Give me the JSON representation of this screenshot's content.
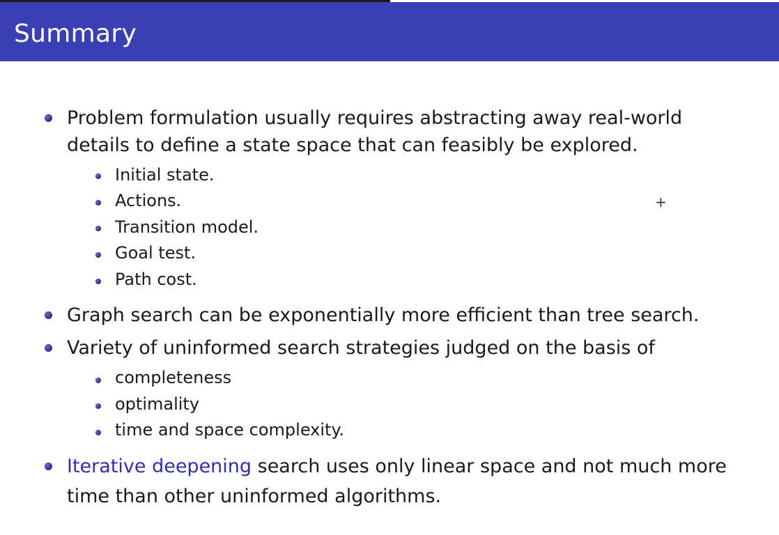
{
  "slide": {
    "title": "Summary",
    "bullets": [
      {
        "text_line1": "Problem formulation usually requires abstracting away real-world",
        "text_line2": "details to define a state space that can feasibly be explored.",
        "subitems": [
          "Initial state.",
          "Actions.",
          "Transition model.",
          "Goal test.",
          "Path cost."
        ]
      },
      {
        "text": "Graph search can be exponentially more efficient than tree search."
      },
      {
        "text": "Variety of uninformed search strategies judged on the basis of",
        "subitems": [
          "completeness",
          "optimality",
          "time and space complexity."
        ]
      },
      {
        "highlight": "Iterative deepening",
        "text_line1_rest": " search uses only linear space and not much more",
        "text_line2": "time than other uninformed algorithms."
      }
    ]
  },
  "colors": {
    "header_bg": "#3a3fb4",
    "bullet": "#2b2b86",
    "highlight_text": "#2f2fb0"
  },
  "cursor_glyph": "+"
}
